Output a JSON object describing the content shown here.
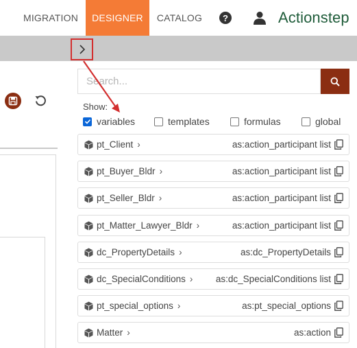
{
  "nav": {
    "tabs": [
      {
        "label": "MIGRATION"
      },
      {
        "label": "DESIGNER",
        "active": true
      },
      {
        "label": "CATALOG"
      }
    ],
    "help_icon_text": "?",
    "logo": "Actionstep",
    "accent_color": "#f47b36",
    "brand_color": "#1f5c3a"
  },
  "toolbar": {
    "expand_icon": "chevron-right-icon",
    "save_icon": "save-icon",
    "undo_icon": "undo-icon"
  },
  "search": {
    "placeholder": "Search...",
    "value": "",
    "button_color": "#8b2e12"
  },
  "filters": {
    "label": "Show:",
    "options": [
      {
        "label": "variables",
        "checked": true
      },
      {
        "label": "templates",
        "checked": false
      },
      {
        "label": "formulas",
        "checked": false
      },
      {
        "label": "global",
        "checked": false
      }
    ]
  },
  "variables": [
    {
      "name": "pt_Client",
      "type": "as:action_participant list"
    },
    {
      "name": "pt_Buyer_Bldr",
      "type": "as:action_participant list"
    },
    {
      "name": "pt_Seller_Bldr",
      "type": "as:action_participant list"
    },
    {
      "name": "pt_Matter_Lawyer_Bldr",
      "type": "as:action_participant list"
    },
    {
      "name": "dc_PropertyDetails",
      "type": "as:dc_PropertyDetails"
    },
    {
      "name": "dc_SpecialConditions",
      "type": "as:dc_SpecialConditions list"
    },
    {
      "name": "pt_special_options",
      "type": "as:pt_special_options"
    },
    {
      "name": "Matter",
      "type": "as:action"
    }
  ]
}
